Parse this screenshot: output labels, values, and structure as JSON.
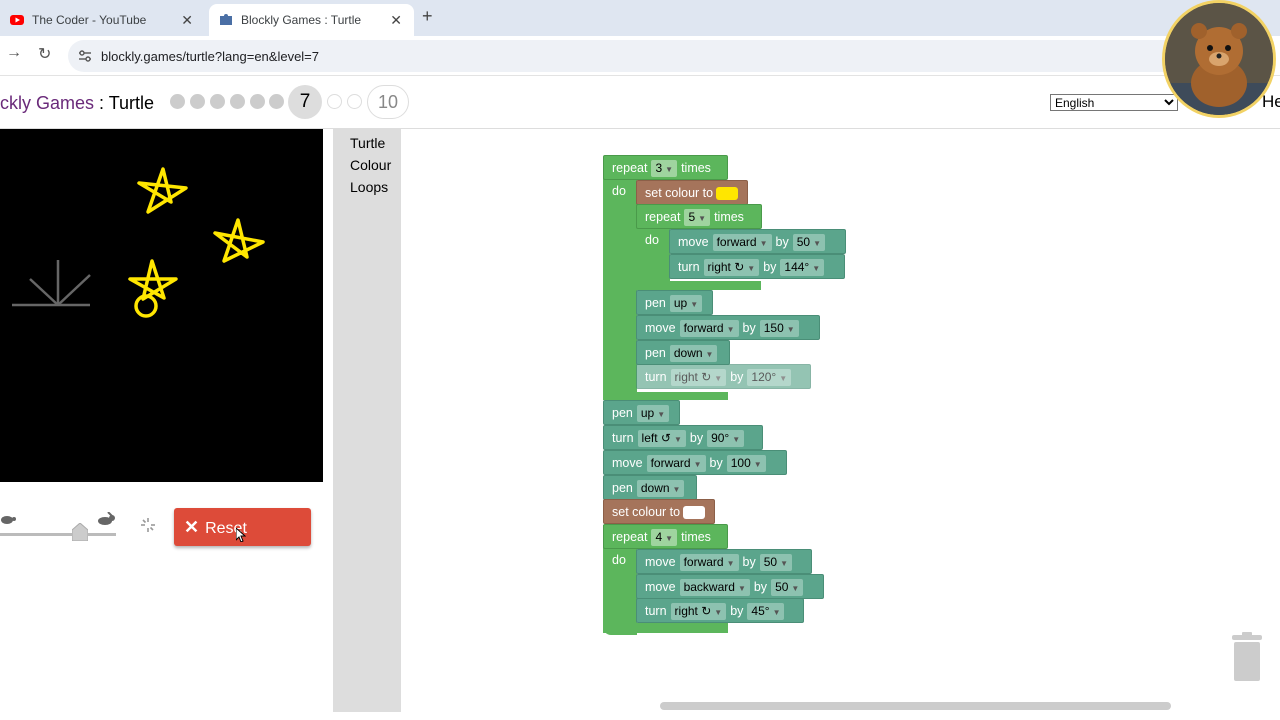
{
  "browser": {
    "tabs": [
      {
        "title": "The Coder - YouTube"
      },
      {
        "title": "Blockly Games : Turtle"
      }
    ],
    "url": "blockly.games/turtle?lang=en&level=7"
  },
  "header": {
    "title_link": "ckly Games",
    "title_sep": " : ",
    "title_game": "Turtle",
    "current_level": "7",
    "last_level": "10",
    "language": "English",
    "help_label": "He"
  },
  "controls": {
    "reset_label": "Reset",
    "speed_level": 0.68
  },
  "toolbox": {
    "categories": [
      "Turtle",
      "Colour",
      "Loops"
    ]
  },
  "program": {
    "kw_repeat": "repeat",
    "kw_times": "times",
    "kw_do": "do",
    "kw_set_colour": "set colour to",
    "kw_move": "move",
    "kw_turn": "turn",
    "kw_pen": "pen",
    "kw_by": "by",
    "outer_repeat": "3",
    "colour_yellow": "#ffe600",
    "colour_white": "#ffffff",
    "inner_repeat": "5",
    "fwd": "forward",
    "bwd": "backward",
    "right": "right ↻",
    "left": "left ↺",
    "up": "up",
    "down": "down",
    "v50": "50",
    "v144": "144°",
    "v150": "150",
    "v120": "120°",
    "v90": "90°",
    "v100": "100",
    "last_repeat": "4",
    "v45": "45°"
  },
  "colors": {
    "loop_green": "#5cb65c",
    "turtle_teal": "#5ba58c",
    "colour_brown": "#a5745b",
    "reset_red": "#dd4b39"
  }
}
